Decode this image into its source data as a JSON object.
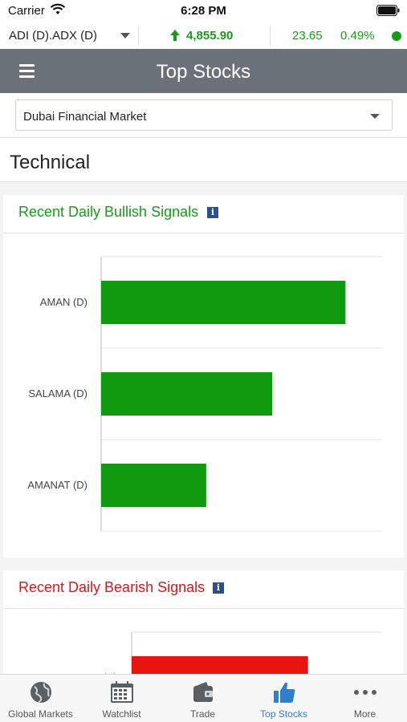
{
  "status_bar": {
    "carrier": "Carrier",
    "time": "6:28 PM"
  },
  "ticker": {
    "symbol": "ADI (D).ADX (D)",
    "price": "4,855.90",
    "change": "23.65",
    "change_pct": "0.49%",
    "direction": "up",
    "up_color": "#1a9a1a"
  },
  "header": {
    "title": "Top Stocks",
    "bg_color": "#6b7178"
  },
  "market_select": {
    "value": "Dubai Financial Market"
  },
  "section": {
    "title": "Technical"
  },
  "bullish": {
    "title": "Recent Daily Bullish Signals",
    "title_color": "#1a9a1a",
    "info_icon": "i"
  },
  "bearish": {
    "title": "Recent Daily Bearish Signals",
    "title_color": "#d9161b",
    "info_icon": "i"
  },
  "chart_data": [
    {
      "type": "bar",
      "orientation": "horizontal",
      "categories": [
        "AMAN (D)",
        "SALAMA (D)",
        "AMANAT (D)"
      ],
      "values": [
        10,
        7,
        4.3
      ],
      "xlim": [
        0,
        11.5
      ],
      "color": "#0f9a0f",
      "grid": true,
      "axis_labels_visible": false
    },
    {
      "type": "bar",
      "orientation": "horizontal",
      "categories": [
        "AMLAK (D)"
      ],
      "values": [
        10
      ],
      "xlim": [
        0,
        14.2
      ],
      "color": "#e8140f",
      "grid": true,
      "axis_labels_visible": false,
      "partially_visible": true
    }
  ],
  "tab_bar": {
    "tabs": [
      {
        "label": "Global Markets",
        "icon": "globe-icon",
        "active": false
      },
      {
        "label": "Watchlist",
        "icon": "calendar-icon",
        "active": false
      },
      {
        "label": "Trade",
        "icon": "wallet-icon",
        "active": false
      },
      {
        "label": "Top Stocks",
        "icon": "thumbs-up-icon",
        "active": true
      },
      {
        "label": "More",
        "icon": "more-dots-icon",
        "active": false
      }
    ],
    "active_color": "#2d7fd0"
  }
}
